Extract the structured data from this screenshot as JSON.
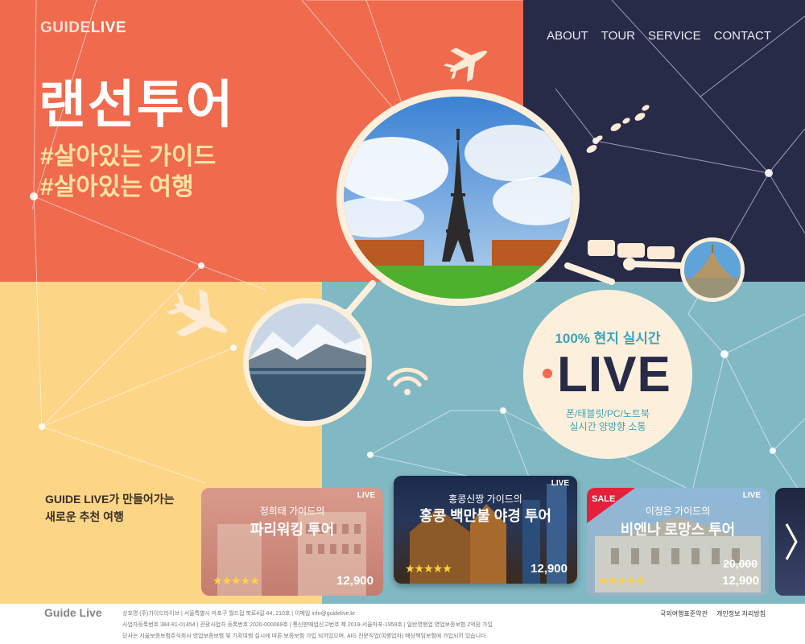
{
  "header": {
    "logo_part1": "GUIDE",
    "logo_part2": "LIVE",
    "nav": [
      "ABOUT",
      "TOUR",
      "SERVICE",
      "CONTACT"
    ]
  },
  "hero": {
    "title": "랜선투어",
    "tag1": "#살아있는 가이드",
    "tag2": "#살아있는 여행"
  },
  "live_badge": {
    "top": "100% 현지 실시간",
    "word": "LIVE",
    "sub1": "폰/태블릿/PC/노트북",
    "sub2": "실시간 양방향 소통"
  },
  "recommend": {
    "line1": "GUIDE LIVE가 만들어가는",
    "line2": "새로운 추천 여행"
  },
  "cards": [
    {
      "guide": "정희태 가이드의",
      "title": "파리워킹 투어",
      "stars": "★★★★★",
      "price": "12,900",
      "live": "LIVE"
    },
    {
      "guide": "홍콩신짱 가이드의",
      "title": "홍콩 백만불 야경 투어",
      "stars": "★★★★★",
      "price": "12,900",
      "live": "LIVE"
    },
    {
      "guide": "이정은 가이드의",
      "title": "비엔나 로망스 투어",
      "stars": "★★★★★",
      "old_price": "20,000",
      "price": "12,900",
      "live": "LIVE",
      "badge": "SALE"
    }
  ],
  "footer": {
    "logo": "Guide Live",
    "line1": "상호명 (주)가이드라이브   |   서울특별시 마포구 월드컵 북로4길 44, 210호   |   이메일 info@guidelive.kr",
    "line2": "사업자등록번호 384-81-01454   |   관광사업자 등록번호 2020-000069호   |   통신판매업신고번호 제 2019-서울마포-1959호   |   일반영행업 영업보증보험 2억원 가입",
    "line3": "당사는 서울보증보험주식회사 영업보증보험 및 기획여행 실시에 따른 보증보험 가입 되어있으며, AIG 전문직업(여행업자) 배상책임보험에 가입되어 있습니다.",
    "link1": "국외여행표준약관",
    "link2": "개인정보 처리방침"
  },
  "colors": {
    "coral": "#f06a4e",
    "navy": "#272b48",
    "yellow": "#fdd587",
    "teal": "#80b8c4",
    "cream": "#fcf0dc"
  }
}
